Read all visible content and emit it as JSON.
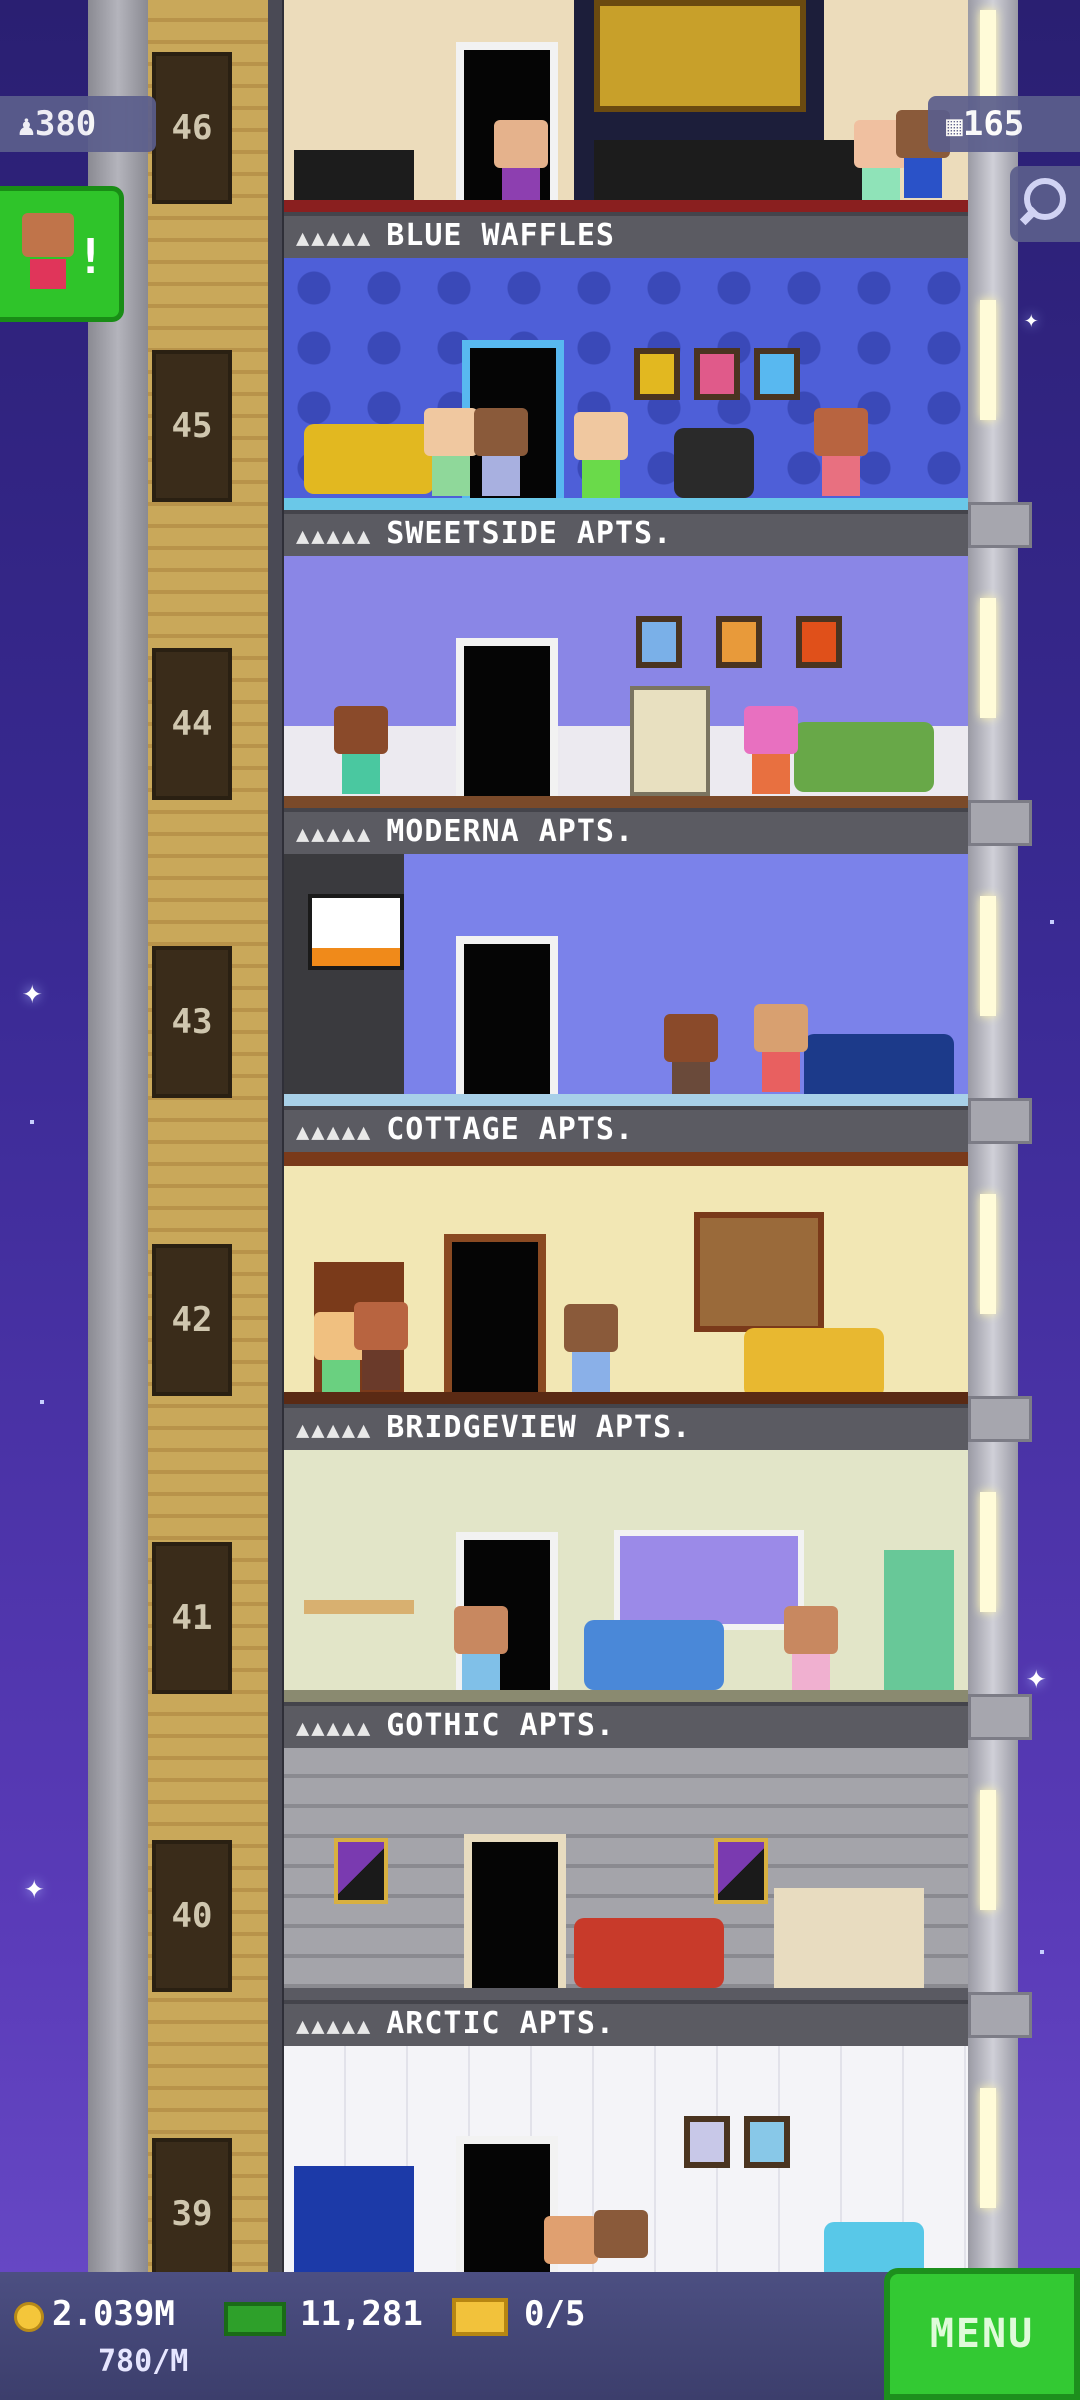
{
  "hud": {
    "population": "380",
    "floors": "165",
    "coins": "2.039M",
    "coin_rate": "780/M",
    "bux": "11,281",
    "vip_tickets": "0/5",
    "menu_label": "MENU"
  },
  "floors": [
    {
      "number": "46",
      "name": "BLUE WAFFLES",
      "wall": "#ecdcbb"
    },
    {
      "number": "45",
      "name": "SWEETSIDE APTS.",
      "wall": "#4e5fd8"
    },
    {
      "number": "44",
      "name": "MODERNA APTS.",
      "wall": "#8a86e6"
    },
    {
      "number": "43",
      "name": "COTTAGE APTS.",
      "wall": "#7b82ea"
    },
    {
      "number": "42",
      "name": "BRIDGEVIEW APTS.",
      "wall": "#f2e7b4"
    },
    {
      "number": "41",
      "name": "GOTHIC APTS.",
      "wall": "#e2e5c8"
    },
    {
      "number": "40",
      "name": "ARCTIC APTS.",
      "wall": "#9e9ea4"
    },
    {
      "number": "39",
      "name": "",
      "wall": "#f4f4f8"
    }
  ],
  "colors": {
    "accent_green": "#33c933",
    "hud_panel": "#5b5e8c",
    "sign_bg": "#5b5b62"
  },
  "icons": [
    "population-icon",
    "floors-icon",
    "search-icon",
    "coin-icon",
    "bux-icon",
    "vip-ticket-icon",
    "notification-icon"
  ]
}
